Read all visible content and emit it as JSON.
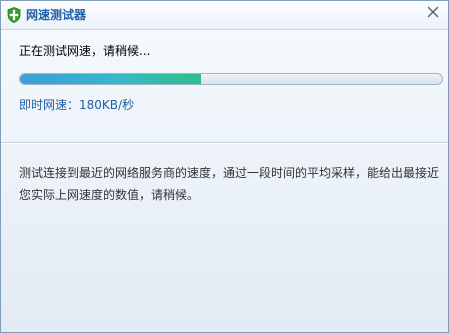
{
  "window": {
    "title": "网速测试器",
    "app_icon": "green-shield-icon",
    "close_icon": "close-icon"
  },
  "status": {
    "message": "正在测试网速，请稍候..."
  },
  "progress": {
    "fraction": 0.43,
    "colors": [
      "#3b9fd8",
      "#38b7c9",
      "#2fbf8a"
    ]
  },
  "speed": {
    "label": "即时网速：",
    "value": "180KB/秒"
  },
  "description": {
    "line1": "测试连接到最近的网络服务商的速度，通过一段时间的平均采样，能给出最接近",
    "line2": "您实际上网速度的数值，请稍候。"
  },
  "colors": {
    "title": "#1f5fa6",
    "speed_text": "#1f5fa6",
    "shield": "#3aa02c"
  }
}
